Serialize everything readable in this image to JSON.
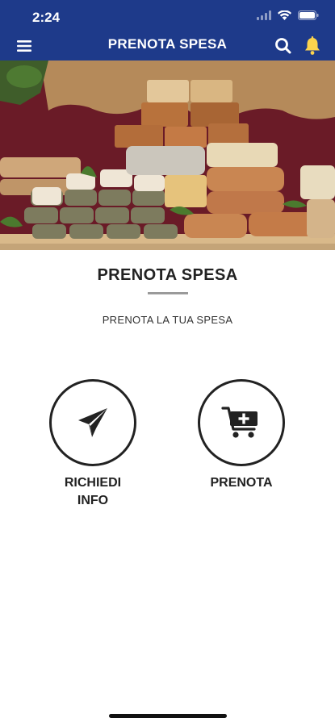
{
  "status_bar": {
    "time": "2:24",
    "icons": [
      "signal-icon",
      "wifi-icon",
      "battery-icon"
    ]
  },
  "app_bar": {
    "title": "PRENOTA SPESA",
    "background_color": "#1e3a8a",
    "icons": [
      "menu-icon",
      "search-icon",
      "bell-icon"
    ]
  },
  "hero": {
    "image_subject": "cheese-display"
  },
  "main": {
    "title": "PRENOTA SPESA",
    "subtitle": "PRENOTA LA TUA SPESA",
    "actions": [
      {
        "label": "RICHIEDI INFO",
        "icon": "paper-plane-icon"
      },
      {
        "label": "PRENOTA",
        "icon": "cart-plus-icon"
      }
    ]
  }
}
